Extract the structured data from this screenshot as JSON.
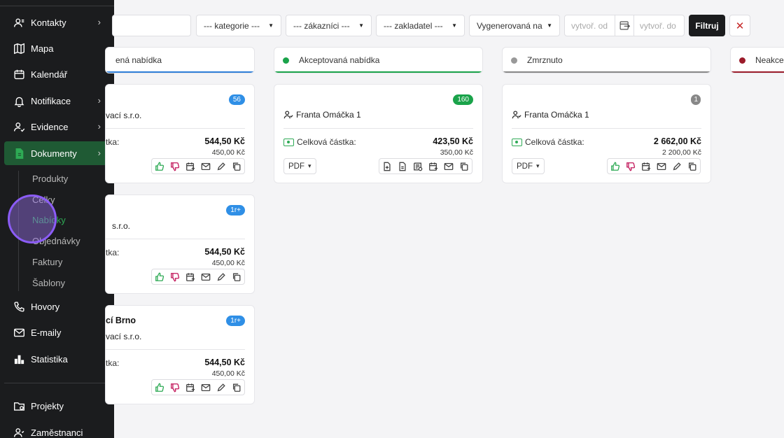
{
  "sidebar": {
    "items": [
      {
        "label": "Kontakty",
        "icon": "contacts-icon",
        "chevron": "›"
      },
      {
        "label": "Mapa",
        "icon": "map-icon",
        "chevron": ""
      },
      {
        "label": "Kalendář",
        "icon": "calendar-icon",
        "chevron": ""
      },
      {
        "label": "Notifikace",
        "icon": "bell-icon",
        "chevron": "›"
      },
      {
        "label": "Evidence",
        "icon": "user-check-icon",
        "chevron": "›"
      },
      {
        "label": "Dokumenty",
        "icon": "document-icon",
        "chevron": "›"
      },
      {
        "label": "Hovory",
        "icon": "phone-icon",
        "chevron": ""
      },
      {
        "label": "E-maily",
        "icon": "mail-icon",
        "chevron": ""
      },
      {
        "label": "Statistika",
        "icon": "stats-icon",
        "chevron": ""
      },
      {
        "label": "Projekty",
        "icon": "folder-icon",
        "chevron": ""
      },
      {
        "label": "Zaměstnanci",
        "icon": "employees-icon",
        "chevron": ""
      }
    ],
    "subitems": [
      "Produkty",
      "Celky",
      "Nabídky",
      "Objednávky",
      "Faktury",
      "Šablony"
    ]
  },
  "toolbar": {
    "category": "--- kategorie ---",
    "customers": "--- zákazníci ---",
    "founder": "--- zakladatel ---",
    "generated": "Vygenerovaná nab",
    "date_from_placeholder": "vytvoř. od",
    "date_to_placeholder": "vytvoř. do",
    "filter_label": "Filtruj",
    "clear_label": "✕"
  },
  "columns": [
    {
      "label": "ená nabídka",
      "color": "#2f7fd8",
      "underline": "#2f7fd8"
    },
    {
      "label": "Akceptovaná nabídka",
      "color": "#1aa34a",
      "underline": "#1aa34a"
    },
    {
      "label": "Zmrznuto",
      "color": "#999999",
      "underline": "#888888"
    },
    {
      "label": "Neakce",
      "color": "#9b1b2a",
      "underline": "#9b1b2a"
    }
  ],
  "cards": {
    "col1": [
      {
        "badge": "56",
        "company": "vací s.r.o.",
        "amount_label": "tka:",
        "amount": "544,50 Kč",
        "amount_sub": "450,00 Kč"
      },
      {
        "badge": "1r+",
        "company": "s.r.o.",
        "amount_label": "tka:",
        "amount": "544,50 Kč",
        "amount_sub": "450,00 Kč"
      },
      {
        "badge": "1r+",
        "title": "cí Brno",
        "company": "vací s.r.o.",
        "amount_label": "tka:",
        "amount": "544,50 Kč",
        "amount_sub": "450,00 Kč"
      }
    ],
    "col2": [
      {
        "badge": "160",
        "person": "Franta Omáčka 1",
        "amount_label": "Celková částka:",
        "amount": "423,50 Kč",
        "amount_sub": "350,00 Kč",
        "pdf": "PDF"
      }
    ],
    "col3": [
      {
        "badge": "1",
        "person": "Franta Omáčka 1",
        "amount_label": "Celková částka:",
        "amount": "2 662,00 Kč",
        "amount_sub": "2 200,00 Kč",
        "pdf": "PDF"
      }
    ]
  },
  "colors": {
    "badge_blue": "#2f8fe6",
    "badge_green": "#1aa34a",
    "badge_gray": "#888888",
    "sidebar_active": "#1f5a34",
    "accent_green": "#2eaa55"
  }
}
